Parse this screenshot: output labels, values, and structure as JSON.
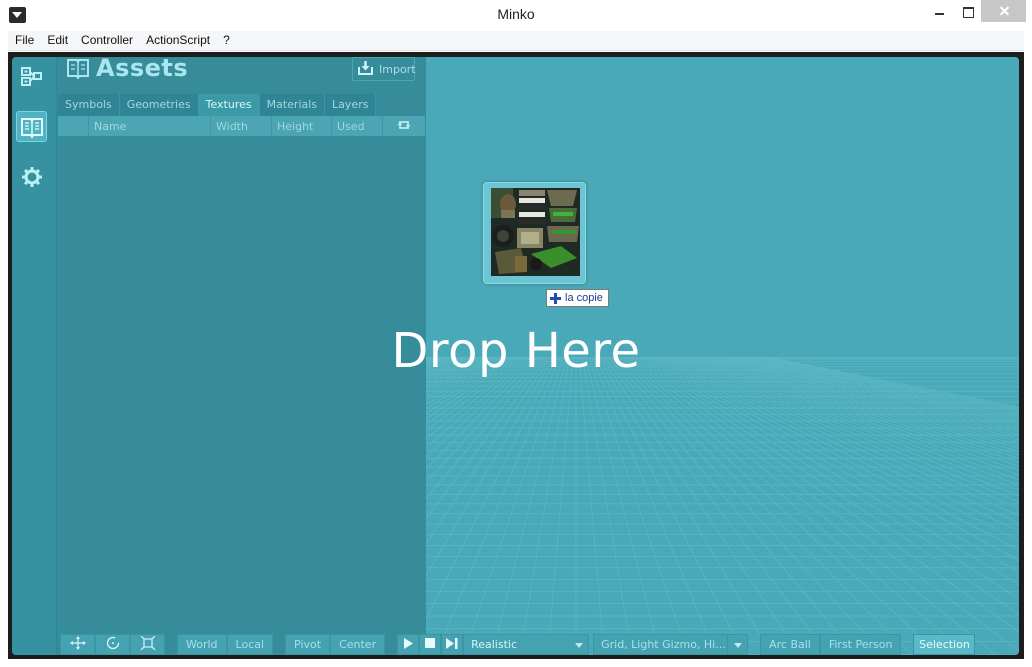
{
  "window": {
    "title": "Minko"
  },
  "menu": [
    "File",
    "Edit",
    "Controller",
    "ActionScript",
    "?"
  ],
  "sidebar": {
    "buttons": [
      {
        "icon": "hierarchy-icon"
      },
      {
        "icon": "book-icon",
        "active": true
      },
      {
        "icon": "gear-icon"
      }
    ]
  },
  "assets": {
    "title": "Assets",
    "import_label": "Import",
    "tabs": [
      {
        "label": "Symbols"
      },
      {
        "label": "Geometries"
      },
      {
        "label": "Textures",
        "active": true
      },
      {
        "label": "Materials"
      },
      {
        "label": "Layers"
      }
    ],
    "columns": [
      "Name",
      "Width",
      "Height",
      "Used"
    ]
  },
  "viewport": {
    "drop_text": "Drop Here",
    "drag_tooltip": "la copie"
  },
  "toolbar": {
    "world": "World",
    "local": "Local",
    "pivot": "Pivot",
    "center": "Center",
    "render_mode": "Realistic",
    "display_options": "Grid, Light Gizmo, Hi...",
    "arc_ball": "Arc Ball",
    "first_person": "First Person",
    "selection": "Selection"
  },
  "colors": {
    "accent": "#3c9aa7",
    "panel": "#368c99",
    "viewport": "#4aa9b8"
  }
}
